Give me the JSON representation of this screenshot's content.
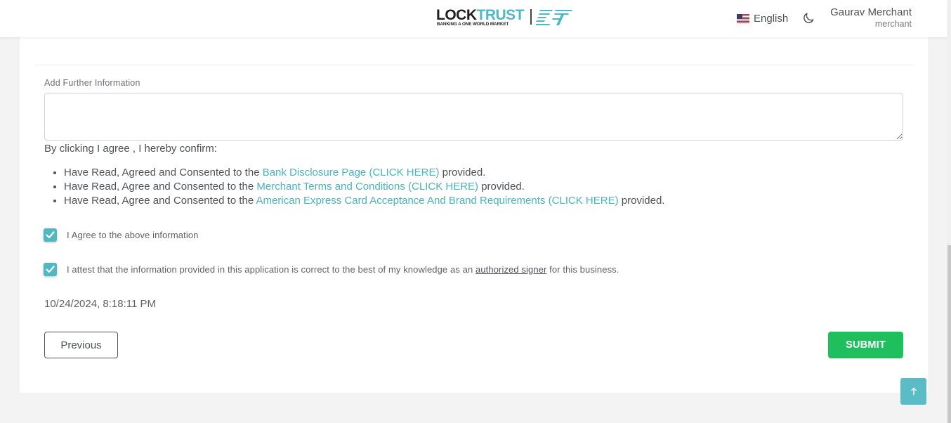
{
  "header": {
    "logo": {
      "word_dark": "LOCK",
      "word_accent": "TRUST",
      "tagline": "BANKING A ONE WORLD MARKET"
    },
    "language": "English",
    "flag_icon": "us-flag-icon",
    "theme_icon": "moon-icon",
    "user_name": "Gaurav Merchant",
    "user_role": "merchant"
  },
  "form": {
    "further_info_label": "Add Further Information",
    "further_info_value": "",
    "confirm_title": "By clicking I agree , I hereby confirm:",
    "terms": [
      {
        "prefix": "Have Read, Agreed and Consented to the ",
        "link": "Bank Disclosure Page (CLICK HERE)",
        "suffix": " provided."
      },
      {
        "prefix": "Have Read, Agree and Consented to the ",
        "link": "Merchant Terms and Conditions (CLICK HERE)",
        "suffix": " provided."
      },
      {
        "prefix": "Have Read, Agree and Consented to the ",
        "link": "American Express Card Acceptance And Brand Requirements (CLICK HERE)",
        "suffix": " provided."
      }
    ],
    "agree_checkbox": {
      "checked": true,
      "label": "I Agree to the above information"
    },
    "attest_checkbox": {
      "checked": true,
      "label_before": "I attest that the information provided in this application is correct to the best of my knowledge as an ",
      "label_link": "authorized signer",
      "label_after": " for this business."
    },
    "timestamp": "10/24/2024, 8:18:11 PM",
    "previous_label": "Previous",
    "submit_label": "SUBMIT"
  },
  "colors": {
    "accent": "#4fb8c3",
    "submit": "#1fbf5d",
    "text": "#4f5257"
  },
  "scroll_to_top_icon": "arrow-up-icon"
}
